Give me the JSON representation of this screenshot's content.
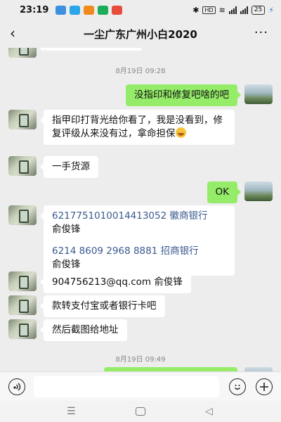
{
  "status": {
    "time": "23:19",
    "right_text": "HD",
    "battery": "25"
  },
  "header": {
    "back_icon": "‹",
    "title": "一尘广东广州小白2020",
    "more_icon": "···"
  },
  "messages": {
    "partial_top": "",
    "ts1": "8月19日 09:28",
    "m1": "没指印和修复吧啥的吧",
    "m2": "指甲印打背光给你看了，我是没看到，修复评级从来没有过，拿命担保",
    "m3": "一手货源",
    "m4": "OK",
    "m5_line1": "6217751010014413052  徽商银行",
    "m5_line2": "俞俊锋",
    "m5_line3": "6214 8609 2968 8881  招商银行",
    "m5_line4": "俞俊锋",
    "m6": "904756213@qq.com  俞俊锋",
    "m7": "款转支付宝或者银行卡吧",
    "m8": "然后截图给地址",
    "ts2": "8月19日 09:49"
  },
  "input": {
    "placeholder": ""
  },
  "colors": {
    "background": "#ededed",
    "self_bubble": "#95ec69",
    "other_bubble": "#ffffff"
  },
  "icons": {
    "voice": "voice-icon",
    "emoji": "emoji-icon",
    "plus": "plus-icon"
  }
}
